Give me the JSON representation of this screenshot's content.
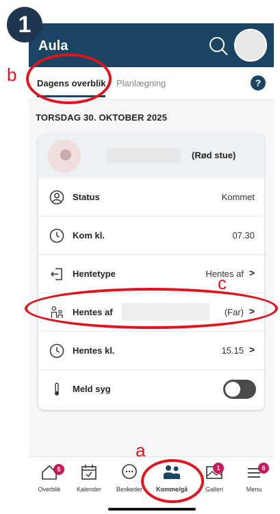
{
  "step": {
    "number": "1"
  },
  "app": {
    "title": "Aula"
  },
  "tabs": [
    {
      "label": "Dagens overblik",
      "active": true
    },
    {
      "label": "Planlægning",
      "active": false
    }
  ],
  "help": {
    "label": "?"
  },
  "date_header": "TORSDAG 30. OKTOBER 2025",
  "child": {
    "room": "(Rød stue)"
  },
  "rows": {
    "status": {
      "label": "Status",
      "value": "Kommet",
      "icon": "person-circle-icon"
    },
    "arrival": {
      "label": "Kom kl.",
      "value": "07.30",
      "icon": "clock-icon"
    },
    "pickup_type": {
      "label": "Hentetype",
      "value": "Hentes af",
      "icon": "exit-door-icon"
    },
    "pickup_by": {
      "label": "Hentes af",
      "value": "(Far)",
      "icon": "family-icon"
    },
    "pickup_time": {
      "label": "Hentes kl.",
      "value": "15.15",
      "icon": "clock-icon"
    },
    "sick": {
      "label": "Meld syg",
      "value": "off",
      "icon": "thermometer-icon"
    }
  },
  "nav": [
    {
      "label": "Overblik",
      "badge": "5",
      "icon": "home-icon"
    },
    {
      "label": "Kalender",
      "badge": "",
      "icon": "calendar-icon"
    },
    {
      "label": "Beskeder",
      "badge": "",
      "icon": "chat-icon"
    },
    {
      "label": "Komme/gå",
      "badge": "",
      "icon": "people-icon",
      "active": true
    },
    {
      "label": "Galleri",
      "badge": "1",
      "icon": "gallery-icon"
    },
    {
      "label": "Menu",
      "badge": "6",
      "icon": "menu-icon"
    }
  ],
  "annotations": {
    "a": "a",
    "b": "b",
    "c": "c",
    "color": "#e0141e"
  },
  "colors": {
    "appbar": "#1b4463",
    "badge": "#c8195a"
  }
}
